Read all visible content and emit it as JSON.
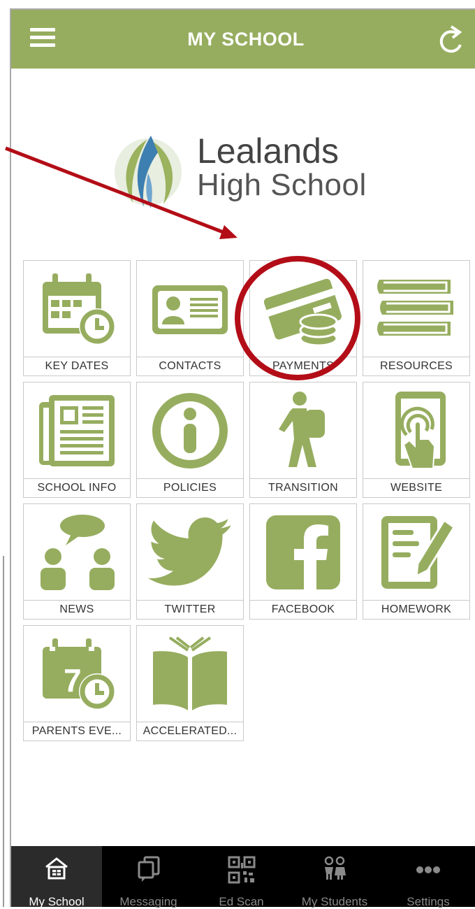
{
  "header": {
    "title": "MY SCHOOL"
  },
  "logo": {
    "name": "Lealands",
    "subtitle": "High School"
  },
  "tiles": [
    {
      "label": "KEY DATES",
      "icon": "calendar-clock-icon"
    },
    {
      "label": "CONTACTS",
      "icon": "contact-card-icon"
    },
    {
      "label": "PAYMENTS",
      "icon": "credit-card-coins-icon"
    },
    {
      "label": "RESOURCES",
      "icon": "books-stack-icon"
    },
    {
      "label": "SCHOOL INFO",
      "icon": "newspaper-icon"
    },
    {
      "label": "POLICIES",
      "icon": "info-icon"
    },
    {
      "label": "TRANSITION",
      "icon": "walking-student-icon"
    },
    {
      "label": "WEBSITE",
      "icon": "tablet-touch-icon"
    },
    {
      "label": "NEWS",
      "icon": "people-chat-icon"
    },
    {
      "label": "TWITTER",
      "icon": "twitter-bird-icon"
    },
    {
      "label": "FACEBOOK",
      "icon": "facebook-icon"
    },
    {
      "label": "HOMEWORK",
      "icon": "document-pencil-icon"
    },
    {
      "label": "PARENTS EVE...",
      "icon": "calendar-seven-icon"
    },
    {
      "label": "ACCELERATED...",
      "icon": "open-book-icon"
    }
  ],
  "tabbar": {
    "items": [
      {
        "label": "My School",
        "icon": "school-house-icon",
        "active": true
      },
      {
        "label": "Messaging",
        "icon": "messaging-icon",
        "active": false
      },
      {
        "label": "Ed Scan",
        "icon": "qr-code-icon",
        "active": false
      },
      {
        "label": "My Students",
        "icon": "students-icon",
        "active": false
      },
      {
        "label": "Settings",
        "icon": "more-dots-icon",
        "active": false
      }
    ]
  },
  "colors": {
    "header": "#96ad5f",
    "tile_icon": "#96ad5f",
    "annotation": "#b30d17",
    "tabbar": "#000000"
  }
}
